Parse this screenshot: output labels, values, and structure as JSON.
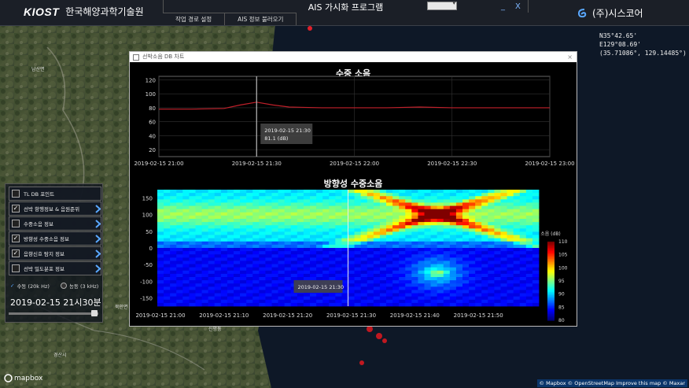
{
  "header": {
    "logo_text": "KIOST",
    "org_name": "한국해양과학기술원",
    "app_title": "AIS 가시화 프로그램",
    "menu": [
      "작업 경로 설정",
      "AIS 정보 불러오기"
    ],
    "minimize": "_",
    "close": "X",
    "brand": "(주)시스코어"
  },
  "coords": {
    "lat": "N35°42.65'",
    "lon": "E129°08.69'",
    "decimal": "(35.71086°, 129.14485°)"
  },
  "panel": {
    "layers": [
      {
        "label": "TL DB 포인트",
        "checked": false,
        "arrow": false
      },
      {
        "label": "선박 항행정보 & 음원준위",
        "checked": true,
        "arrow": true
      },
      {
        "label": "수중소음 정보",
        "checked": false,
        "arrow": true
      },
      {
        "label": "방향성 수중소음 정보",
        "checked": true,
        "arrow": true
      },
      {
        "label": "음향신호 탐지 정보",
        "checked": true,
        "arrow": true
      },
      {
        "label": "선박 밀도분포 정보",
        "checked": false,
        "arrow": true
      }
    ],
    "mode_check": "✓",
    "mode_passive": "수동 (20k Hz)",
    "mode_active": "능동 (3 kHz)",
    "datetime": "2019-02-15 21시30분",
    "slider_position": 0.95
  },
  "map": {
    "places": [
      "남산면",
      "북안면",
      "경산시",
      "신평동"
    ],
    "mapbox": "mapbox",
    "attribution": "© Mapbox © OpenStreetMap Improve this map © Maxar"
  },
  "dialog": {
    "title": "선박소음 DB 차트",
    "close": "×"
  },
  "chart_data": [
    {
      "type": "line",
      "title": "수중 소음",
      "x": [
        "2019-02-15 21:00",
        "2019-02-15 21:30",
        "2019-02-15 22:00",
        "2019-02-15 22:30",
        "2019-02-15 23:00"
      ],
      "x_minutes": [
        0,
        10,
        20,
        25,
        30,
        35,
        40,
        50,
        60,
        70,
        80,
        90,
        100,
        110,
        120
      ],
      "values": [
        78,
        78,
        79,
        84,
        88,
        84,
        81,
        80,
        80,
        80,
        81,
        80,
        80,
        80,
        80
      ],
      "series_color": "#c0202a",
      "yticks": [
        20,
        40,
        60,
        80,
        100,
        120
      ],
      "ylim": [
        10,
        125
      ],
      "tooltip": {
        "time": "2019-02-15 21:30",
        "value": "81.1 (dB)"
      },
      "cursor_minutes": 30,
      "grid": true
    },
    {
      "type": "heatmap",
      "title": "방향성 수중소음",
      "x": [
        "2019-02-15 21:00",
        "2019-02-15 21:10",
        "2019-02-15 21:20",
        "2019-02-15 21:30",
        "2019-02-15 21:40",
        "2019-02-15 21:50"
      ],
      "yticks": [
        150,
        100,
        50,
        0,
        -50,
        -100,
        -150
      ],
      "ylim": [
        -175,
        175
      ],
      "colorbar": {
        "label": "소음 (dB)",
        "ticks": [
          110,
          105,
          100,
          95,
          90,
          85,
          80
        ],
        "range": [
          80,
          110
        ]
      },
      "tooltip": {
        "time": "2019-02-15 21:30"
      },
      "cursor_minutes": 30
    }
  ]
}
